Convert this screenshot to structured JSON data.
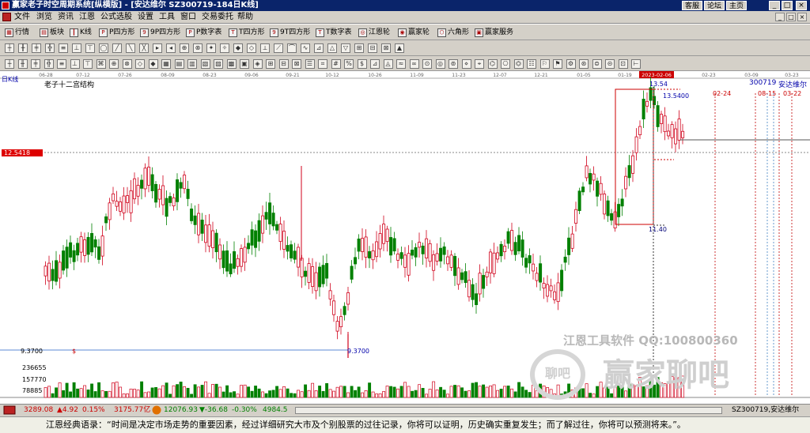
{
  "window": {
    "title": "赢家老子时空周期系统[纵横版] - [安达维尔  SZ300719-184日K线]",
    "links": [
      "客服",
      "论坛",
      "主页"
    ],
    "controls": [
      "_",
      "□",
      "×"
    ]
  },
  "menu": {
    "items": [
      "文件",
      "浏览",
      "资讯",
      "江恩",
      "公式选股",
      "设置",
      "工具",
      "窗口",
      "交易委托",
      "帮助"
    ],
    "right_controls": [
      "_",
      "□",
      "×"
    ]
  },
  "toolbar1": {
    "buttons": [
      {
        "label": "行情",
        "icon": "grid-icon"
      },
      {
        "label": "板块",
        "icon": "blocks-icon"
      },
      {
        "label": "K线",
        "icon": "candles-icon"
      },
      {
        "label": "P四方形",
        "icon": "p-square-icon"
      },
      {
        "label": "9P四方形",
        "icon": "9p-square-icon"
      },
      {
        "label": "P数字表",
        "icon": "p-number-icon"
      },
      {
        "label": "T四方形",
        "icon": "t-square-icon"
      },
      {
        "label": "9T四方形",
        "icon": "9t-square-icon"
      },
      {
        "label": "T数字表",
        "icon": "t-number-icon"
      },
      {
        "label": "江恩轮",
        "icon": "gann-wheel-icon"
      },
      {
        "label": "赢家轮",
        "icon": "winner-wheel-icon"
      },
      {
        "label": "六角形",
        "icon": "hexagon-icon"
      },
      {
        "label": "赢家服务",
        "icon": "service-icon"
      }
    ]
  },
  "chart": {
    "period_label": "日K线",
    "structure_label": "老子十二宫结构",
    "stock_code": "300719",
    "stock_name": "安达维尔",
    "price_marker": "12.5418",
    "high_label": "13.54",
    "high_value_label": "13.5400",
    "low_label": "11.40",
    "bottom_low_label": "9.3700",
    "axis_low_label": "9.3700",
    "volume_ticks": [
      "236655",
      "157770",
      "78885"
    ],
    "date_labels": [
      "06-28",
      "07-12",
      "07-26",
      "08-09",
      "08-23",
      "09-06",
      "09-21",
      "10-12",
      "10-26",
      "11-09",
      "11-23",
      "12-07",
      "12-21",
      "01-05",
      "01-19",
      "02-23",
      "03-09",
      "03-23"
    ],
    "highlight_date": "2023-02-06",
    "future_labels": [
      "02-24",
      "08-15",
      "03-22"
    ],
    "dollar_marker": "$",
    "colors": {
      "up": "#d0021b",
      "down": "#008000",
      "highlight": "#cc0000",
      "accent": "#0000aa"
    }
  },
  "watermark": {
    "line1": "江恩工具软件  QQ:100800360",
    "brand": "赢家聊吧",
    "badge": "聊吧"
  },
  "statusbar": {
    "index1_value": "3289.08",
    "index1_change": "▲4.92",
    "index1_pct": "0.15%",
    "index1_amount": "3175.77亿",
    "index2_value": "12076.93",
    "index2_change": "▼-36.68",
    "index2_pct": "-0.30%",
    "index2_amount": "4984.5",
    "current_stock": "SZ300719,安达维尔"
  },
  "quote": {
    "text": "江恩经典语录：“时间是决定市场走势的重要因素，经过详细研究大市及个别股票的过往记录，你将可以证明，历史确实重复发生；而了解过往，你将可以预测将来。”。"
  }
}
